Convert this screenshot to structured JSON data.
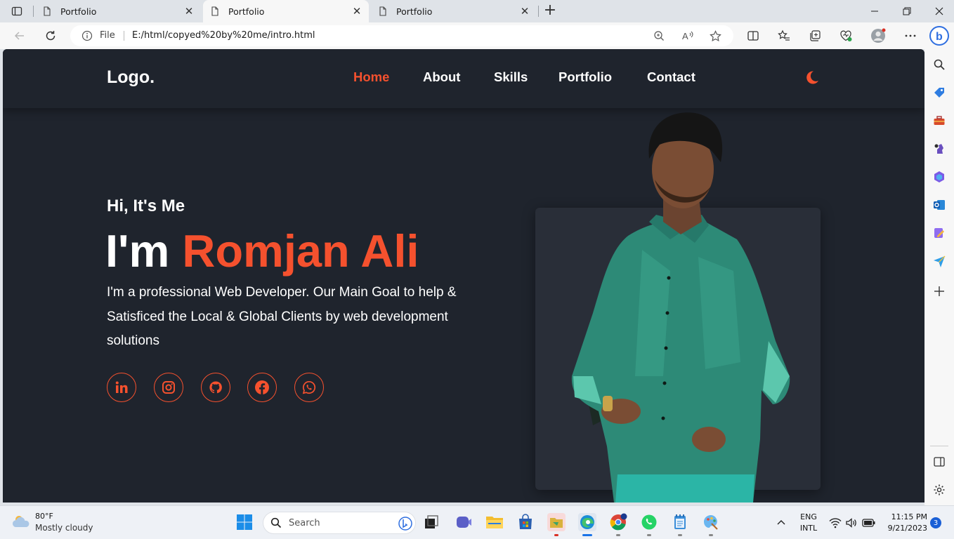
{
  "browser": {
    "tabs": [
      {
        "title": "Portfolio",
        "active": false
      },
      {
        "title": "Portfolio",
        "active": true
      },
      {
        "title": "Portfolio",
        "active": false
      }
    ],
    "address": {
      "scheme_label": "File",
      "url": "E:/html/copyed%20by%20me/intro.html"
    },
    "bing_badge": "b"
  },
  "site": {
    "logo": "Logo.",
    "nav": [
      {
        "label": "Home",
        "active": true
      },
      {
        "label": "About",
        "active": false
      },
      {
        "label": "Skills",
        "active": false
      },
      {
        "label": "Portfolio",
        "active": false
      },
      {
        "label": "Contact",
        "active": false
      }
    ],
    "theme_toggle_icon": "moon-icon",
    "greeting": "Hi, It's Me",
    "headline_prefix": "I'm ",
    "headline_name": "Romjan Ali",
    "description": "I'm a professional Web Developer. Our Main Goal to help & Satisficed the Local & Global Clients by web development solutions",
    "social_icons": [
      "linkedin-icon",
      "instagram-icon",
      "github-icon",
      "facebook-icon",
      "whatsapp-icon"
    ],
    "accent_color": "#f5512e",
    "background_color": "#1f242d"
  },
  "taskbar": {
    "weather": {
      "temp": "80°F",
      "condition": "Mostly cloudy"
    },
    "search_placeholder": "Search",
    "tray": {
      "language_line1": "ENG",
      "language_line2": "INTL",
      "time": "11:15 PM",
      "date": "9/21/2023",
      "notifications": "3"
    }
  }
}
